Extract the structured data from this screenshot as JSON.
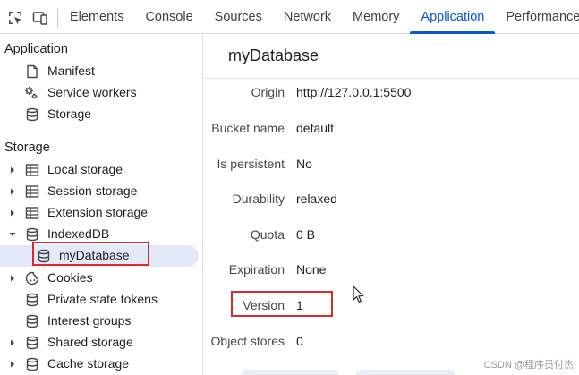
{
  "toolbar": {
    "inspect_icon": "select-element-icon",
    "device_icon": "device-toolbar-icon"
  },
  "tabs": [
    {
      "label": "Elements"
    },
    {
      "label": "Console"
    },
    {
      "label": "Sources"
    },
    {
      "label": "Network"
    },
    {
      "label": "Memory"
    },
    {
      "label": "Application",
      "active": true
    },
    {
      "label": "Performance"
    }
  ],
  "sidebar": {
    "app_section": "Application",
    "app_items": [
      {
        "label": "Manifest",
        "icon": "document-icon"
      },
      {
        "label": "Service workers",
        "icon": "gears-icon"
      },
      {
        "label": "Storage",
        "icon": "database-icon"
      }
    ],
    "storage_section": "Storage",
    "storage_items": [
      {
        "label": "Local storage",
        "icon": "table-icon"
      },
      {
        "label": "Session storage",
        "icon": "table-icon"
      },
      {
        "label": "Extension storage",
        "icon": "table-icon"
      },
      {
        "label": "IndexedDB",
        "icon": "database-icon"
      },
      {
        "label": "myDatabase",
        "icon": "database-icon"
      },
      {
        "label": "Cookies",
        "icon": "cookie-icon"
      },
      {
        "label": "Private state tokens",
        "icon": "database-icon"
      },
      {
        "label": "Interest groups",
        "icon": "database-icon"
      },
      {
        "label": "Shared storage",
        "icon": "database-icon"
      },
      {
        "label": "Cache storage",
        "icon": "database-icon"
      }
    ]
  },
  "main": {
    "title": "myDatabase",
    "rows": [
      {
        "key": "Origin",
        "value": "http://127.0.0.1:5500"
      },
      {
        "key": "Bucket name",
        "value": "default"
      },
      {
        "key": "Is persistent",
        "value": "No"
      },
      {
        "key": "Durability",
        "value": "relaxed"
      },
      {
        "key": "Quota",
        "value": "0 B"
      },
      {
        "key": "Expiration",
        "value": "None"
      },
      {
        "key": "Version",
        "value": "1"
      },
      {
        "key": "Object stores",
        "value": "0"
      }
    ]
  },
  "watermark": "CSDN @程序员付杰",
  "colors": {
    "accent": "#0b57d0",
    "highlight_box": "#d92b2b",
    "selected_bg": "#e3e9f6"
  }
}
